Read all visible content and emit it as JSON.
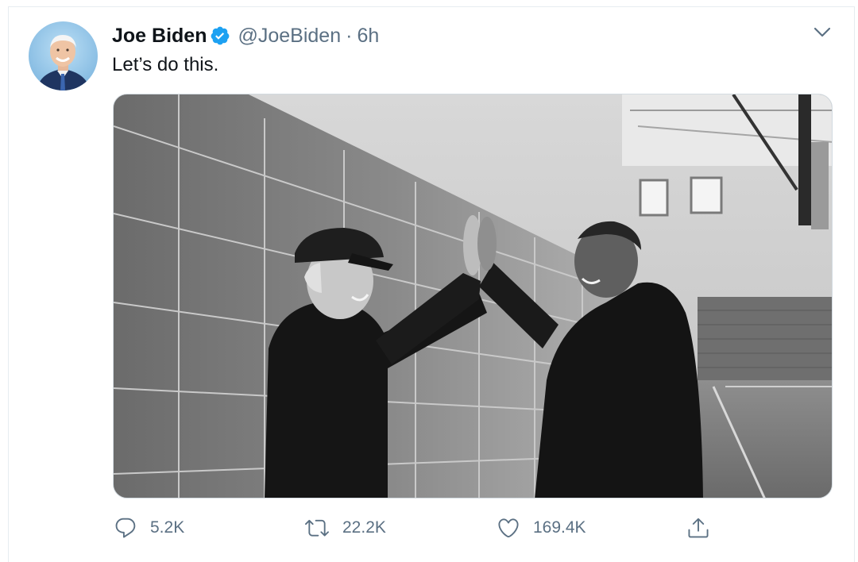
{
  "tweet": {
    "display_name": "Joe Biden",
    "handle": "@JoeBiden",
    "separator": "·",
    "timestamp": "6h",
    "text": "Let’s do this.",
    "verified": true
  },
  "actions": {
    "reply_count": "5.2K",
    "retweet_count": "22.2K",
    "like_count": "169.4K"
  },
  "icons": {
    "verified": "verified-badge-icon",
    "more": "chevron-down-icon",
    "reply": "reply-icon",
    "retweet": "retweet-icon",
    "like": "heart-icon",
    "share": "share-icon"
  },
  "colors": {
    "accent": "#1da1f2",
    "text": "#0f1419",
    "muted": "#5b7083",
    "border": "#e6ecf0"
  }
}
